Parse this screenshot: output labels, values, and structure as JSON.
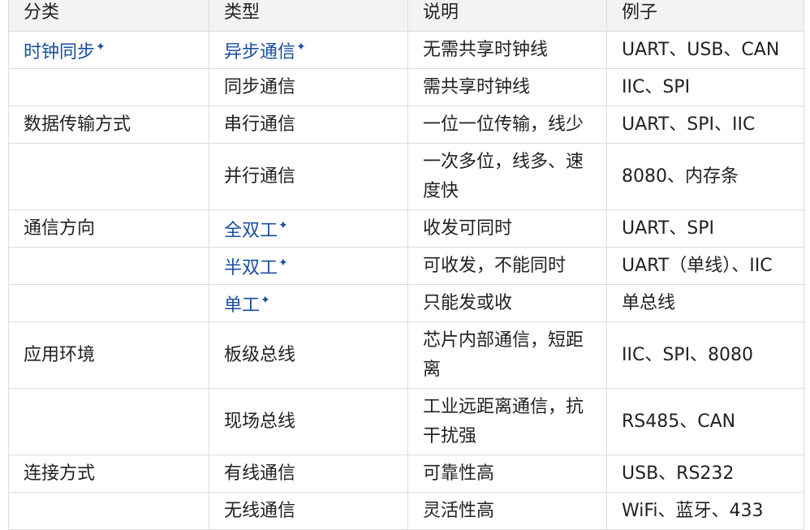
{
  "headers": [
    "分类",
    "类型",
    "说明",
    "例子"
  ],
  "rows": [
    {
      "category": "时钟同步",
      "category_link": true,
      "type": "异步通信",
      "type_link": true,
      "desc": "无需共享时钟线",
      "example": "UART、USB、CAN"
    },
    {
      "category": "",
      "category_link": false,
      "type": "同步通信",
      "type_link": false,
      "desc": "需共享时钟线",
      "example": "IIC、SPI"
    },
    {
      "category": "数据传输方式",
      "category_link": false,
      "type": "串行通信",
      "type_link": false,
      "desc": "一位一位传输，线少",
      "example": "UART、SPI、IIC"
    },
    {
      "category": "",
      "category_link": false,
      "type": "并行通信",
      "type_link": false,
      "desc": "一次多位，线多、速度快",
      "example": "8080、内存条"
    },
    {
      "category": "通信方向",
      "category_link": false,
      "type": "全双工",
      "type_link": true,
      "desc": "收发可同时",
      "example": "UART、SPI"
    },
    {
      "category": "",
      "category_link": false,
      "type": "半双工",
      "type_link": true,
      "desc": "可收发，不能同时",
      "example": "UART（单线）、IIC"
    },
    {
      "category": "",
      "category_link": false,
      "type": "单工",
      "type_link": true,
      "desc": "只能发或收",
      "example": "单总线"
    },
    {
      "category": "应用环境",
      "category_link": false,
      "type": "板级总线",
      "type_link": false,
      "desc": "芯片内部通信，短距离",
      "example": "IIC、SPI、8080"
    },
    {
      "category": "",
      "category_link": false,
      "type": "现场总线",
      "type_link": false,
      "desc": "工业远距离通信，抗干扰强",
      "example": "RS485、CAN"
    },
    {
      "category": "连接方式",
      "category_link": false,
      "type": "有线通信",
      "type_link": false,
      "desc": "可靠性高",
      "example": "USB、RS232"
    },
    {
      "category": "",
      "category_link": false,
      "type": "无线通信",
      "type_link": false,
      "desc": "灵活性高",
      "example": "WiFi、蓝牙、433"
    }
  ],
  "link_marker": "✦",
  "colors": {
    "link": "#1a4e9e",
    "header_bg": "#f3f3f5",
    "border": "#dcdcdc"
  }
}
